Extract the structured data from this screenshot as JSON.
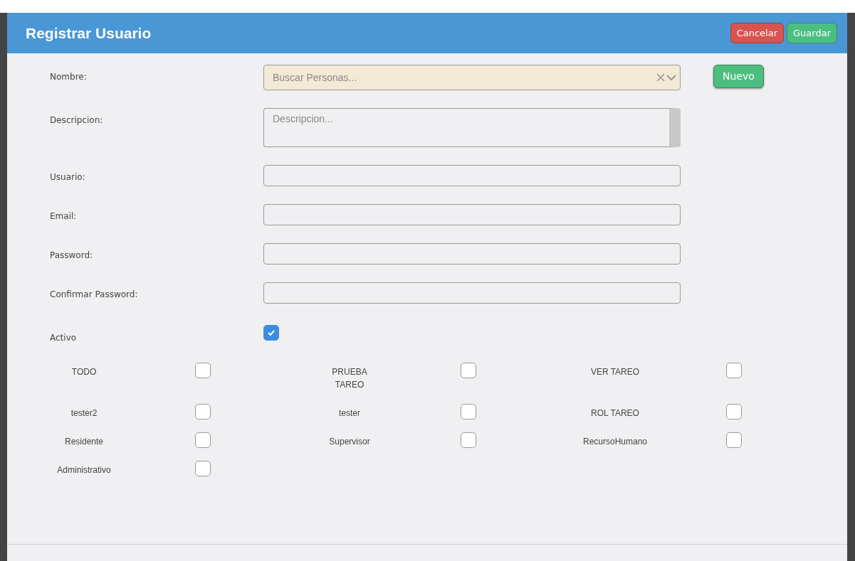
{
  "modal": {
    "title": "Registrar Usuario",
    "buttons": [
      {
        "label": "Cancelar",
        "kind": "danger"
      },
      {
        "label": "Guardar",
        "kind": "success"
      }
    ]
  },
  "fields": [
    {
      "label": "Nombre:",
      "kind": "select",
      "placeholder": "Buscar Personas..."
    },
    {
      "label": "Descripcion:",
      "kind": "textarea",
      "placeholder": "Descripcion..."
    },
    {
      "label": "Usuario:",
      "kind": "text"
    },
    {
      "label": "Email:",
      "kind": "text"
    },
    {
      "label": "Password:",
      "kind": "password"
    },
    {
      "label": "Confirmar Password:",
      "kind": "password"
    },
    {
      "label": "Activo",
      "kind": "checkbox",
      "checked": true
    }
  ],
  "new_button": "Nuevo",
  "roles": [
    {
      "label": "TODO",
      "checked": false
    },
    {
      "label": "PRUEBA TAREO",
      "checked": false
    },
    {
      "label": "VER TAREO",
      "checked": false
    },
    {
      "label": "tester2",
      "checked": false
    },
    {
      "label": "tester",
      "checked": false
    },
    {
      "label": "ROL TAREO",
      "checked": false
    },
    {
      "label": "Residente",
      "checked": false
    },
    {
      "label": "Supervisor",
      "checked": false
    },
    {
      "label": "RecursoHumano",
      "checked": false
    },
    {
      "label": "Administrativo",
      "checked": false
    }
  ]
}
